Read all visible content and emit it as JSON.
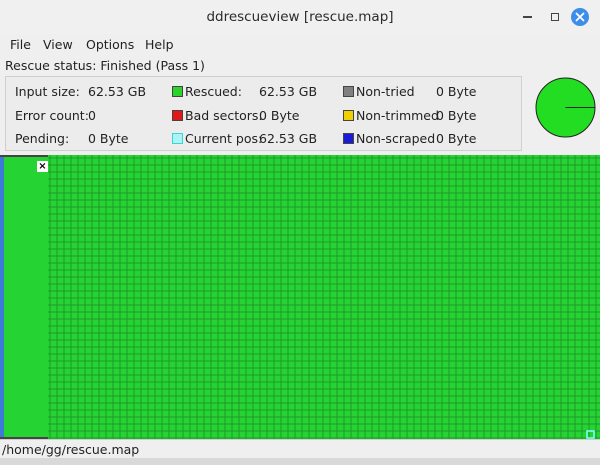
{
  "window": {
    "title": "ddrescueview [rescue.map]"
  },
  "menu": [
    "File",
    "View",
    "Options",
    "Help"
  ],
  "status": {
    "label": "Rescue status:",
    "value": "Finished (Pass 1)"
  },
  "info": {
    "input_size": {
      "label": "Input size:",
      "value": "62.53 GB"
    },
    "error_count": {
      "label": "Error count:",
      "value": "0"
    },
    "pending": {
      "label": "Pending:",
      "value": "0 Byte"
    },
    "rescued": {
      "label": "Rescued:",
      "value": "62.53 GB",
      "color": "#2ad42a"
    },
    "bad_sectors": {
      "label": "Bad sectors:",
      "value": "0 Byte",
      "color": "#e01818"
    },
    "current_pos": {
      "label": "Current pos:",
      "value": "62.53 GB",
      "color": "#aef3f3"
    },
    "non_tried": {
      "label": "Non-tried",
      "value": "0 Byte",
      "color": "#808080"
    },
    "non_trimmed": {
      "label": "Non-trimmed",
      "value": "0 Byte",
      "color": "#f0d000"
    },
    "non_scraped": {
      "label": "Non-scraped",
      "value": "0 Byte",
      "color": "#1a1ad8"
    }
  },
  "pie": {
    "rescued_fraction": 1.0,
    "color": "#22dd22"
  },
  "map": {
    "block_color": "#25d433",
    "grid_color": "#1f9a2a",
    "current_pos_marker_color": "#7fffff"
  },
  "statusbar": {
    "path": "/home/gg/rescue.map"
  }
}
